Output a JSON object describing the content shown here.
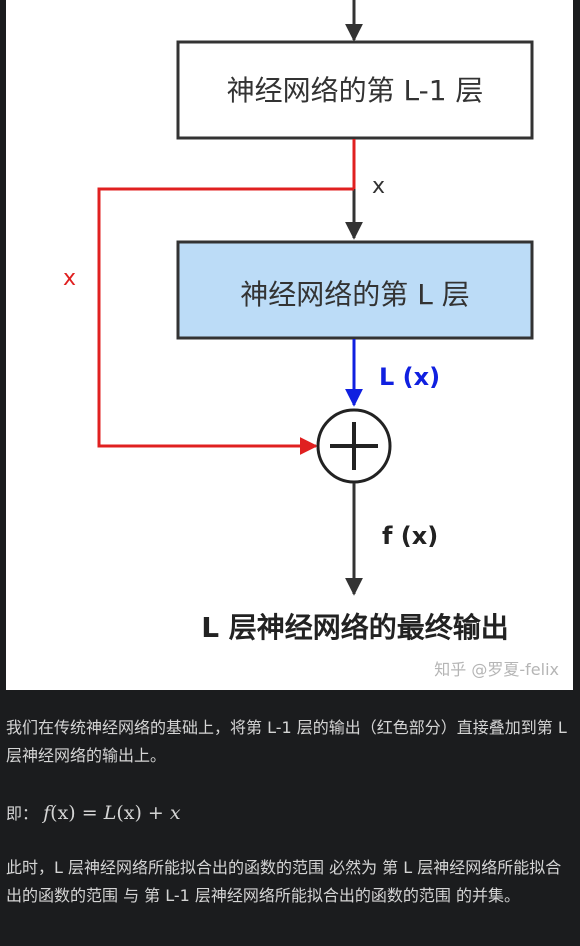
{
  "diagram": {
    "box_top_label": "神经网络的第 L-1 层",
    "box_main_label": "神经网络的第 L 层",
    "edge_top_label": "x",
    "edge_skip_label": "x",
    "edge_out_label": "L (x)",
    "edge_final_label": "f (x)",
    "output_label": "L 层神经网络的最终输出",
    "watermark": "知乎 @罗夏-felix",
    "colors": {
      "skip_path": "#e02020",
      "main_output_path": "#1020e0",
      "main_box_fill": "#bcdcf7",
      "arrow": "#333333"
    },
    "icons": {
      "sum_node": "plus-circle-icon"
    }
  },
  "text": {
    "para1": "我们在传统神经网络的基础上，将第 L-1 层的输出（红色部分）直接叠加到第 L 层神经网络的输出上。",
    "formula_prefix": "即：",
    "formula_lhs_fn": "f",
    "formula_lhs_arg": "(x)",
    "formula_equals": " = ",
    "formula_rhs_fn": "L",
    "formula_rhs_arg": "(x)",
    "formula_plus": " + ",
    "formula_rhs_var": "x",
    "para2": "此时，L 层神经网络所能拟合出的函数的范围 必然为 第 L 层神经网络所能拟合出的函数的范围 与 第 L-1 层神经网络所能拟合出的函数的范围 的并集。"
  }
}
